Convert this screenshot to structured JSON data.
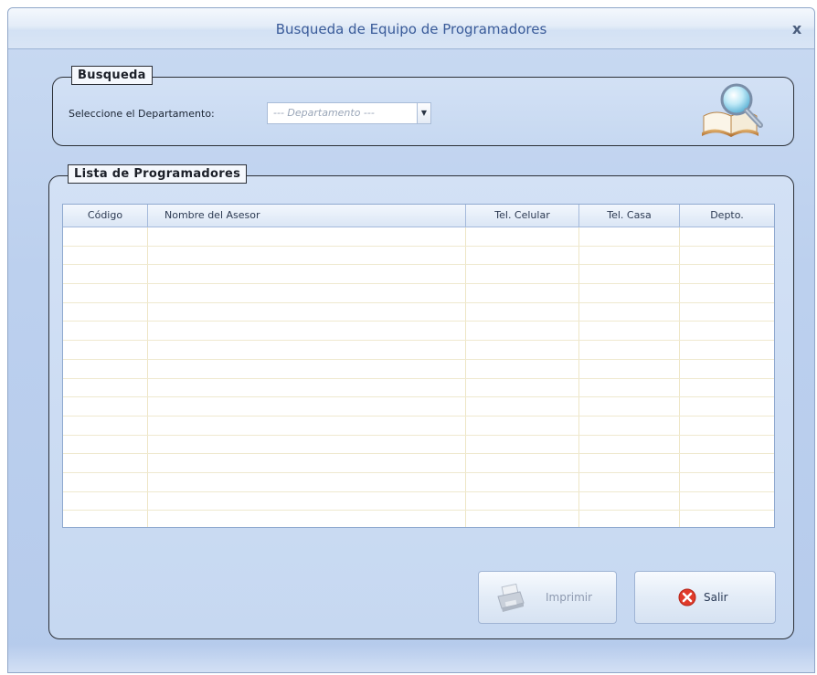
{
  "window": {
    "title": "Busqueda de Equipo de Programadores",
    "close_label": "x"
  },
  "search_group": {
    "legend": "Busqueda",
    "label": "Seleccione el Departamento:",
    "select_value": "--- Departamento ---",
    "icon": "book-magnifier-icon"
  },
  "list_group": {
    "legend": "Lista de Programadores",
    "columns": [
      "Código",
      "Nombre del Asesor",
      "Tel. Celular",
      "Tel. Casa",
      "Depto."
    ],
    "rows": []
  },
  "buttons": {
    "print_label": "Imprimir",
    "exit_label": "Salir"
  },
  "colors": {
    "title_text": "#3a5b99",
    "window_bg": "#c4d7f0",
    "disabled_text": "#8e9ab0",
    "exit_icon": "#e03a2a"
  }
}
